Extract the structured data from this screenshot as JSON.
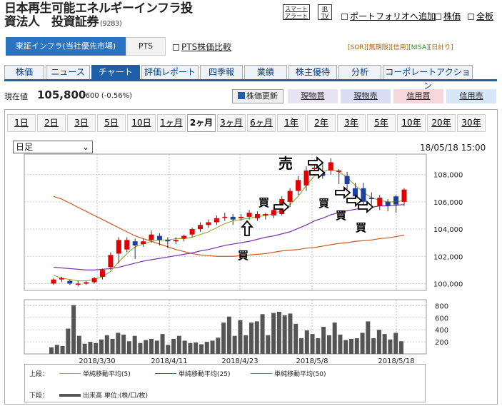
{
  "header": {
    "title_line1": "日本再生可能エネルギーインフラ投",
    "title_line2": "資法人　投資証券",
    "code": "(9283)",
    "smart_alert": "スマート アラート",
    "irtv": "IR TV",
    "portfolio": "ポートフォリオへ追加",
    "stock_price": "株価",
    "full_board": "全板"
  },
  "market": {
    "selected": "東証インフラ(当社優先市場)",
    "pts": "PTS",
    "pts_compare": "PTS株価比較",
    "flags": [
      "[SOR]",
      "[無期限]",
      "[信用]",
      "[NISA]",
      "[日計り]"
    ]
  },
  "tabs": [
    "株価",
    "ニュース",
    "チャート",
    "評価レポート",
    "四季報",
    "業績",
    "株主優待",
    "分析",
    "コーポレートアクション"
  ],
  "price": {
    "label": "現在値",
    "value": "105,800",
    "change": "-600 (-0.56%)",
    "refresh": "株価更新",
    "buy_spot": "現物買",
    "sell_spot": "現物売",
    "buy_margin": "信用買",
    "sell_margin": "信用売"
  },
  "periods": [
    "1日",
    "2日",
    "3日",
    "5日",
    "10日",
    "1ヶ月",
    "2ヶ月",
    "3ヶ月",
    "6ヶ月",
    "1年",
    "2年",
    "3年",
    "5年",
    "10年",
    "20年",
    "30年"
  ],
  "active_period": "2ヶ月",
  "select_value": "日足",
  "datetime": "18/05/18 15:00",
  "annotations": {
    "sell": "売",
    "buy": "買"
  },
  "legend": {
    "upper": "上段：",
    "lower": "下段：",
    "ma5": "単純移動平均(5)",
    "ma25": "単純移動平均(25)",
    "ma50": "単純移動平均(50)",
    "volume": "出来高 単位:(株/口/枚)"
  },
  "colors": {
    "up": "#e00000",
    "down": "#1c3fa0",
    "ma5": "#a2a93a",
    "ma25": "#7a2fb0",
    "ma50": "#c85a22",
    "volume": "#555555",
    "tab_blue": "#1f5fa8"
  },
  "chart_data": [
    {
      "type": "candlestick",
      "y_ticks": [
        100000,
        102000,
        104000,
        106000,
        108000
      ],
      "ylim": [
        99500,
        109500
      ],
      "x_labels": [
        "2018/3/30",
        "2018/4/11",
        "2018/4/23",
        "2018/5/8",
        "2018/5/18"
      ],
      "candles": [
        {
          "o": 100000,
          "c": 100300,
          "h": 100400,
          "l": 99900
        },
        {
          "o": 100300,
          "c": 100400,
          "h": 100500,
          "l": 100100
        },
        {
          "o": 100200,
          "c": 100000,
          "h": 100300,
          "l": 99900
        },
        {
          "o": 100000,
          "c": 100000,
          "h": 100200,
          "l": 99800
        },
        {
          "o": 100000,
          "c": 100100,
          "h": 100200,
          "l": 99900
        },
        {
          "o": 100100,
          "c": 100400,
          "h": 100500,
          "l": 100000
        },
        {
          "o": 100500,
          "c": 101000,
          "h": 101100,
          "l": 100300
        },
        {
          "o": 101200,
          "c": 102100,
          "h": 102300,
          "l": 101000
        },
        {
          "o": 102200,
          "c": 103200,
          "h": 103400,
          "l": 101500
        },
        {
          "o": 102500,
          "c": 103200,
          "h": 103400,
          "l": 102300
        },
        {
          "o": 103100,
          "c": 102800,
          "h": 103300,
          "l": 101800
        },
        {
          "o": 102900,
          "c": 103100,
          "h": 103300,
          "l": 102700
        },
        {
          "o": 103200,
          "c": 103600,
          "h": 103900,
          "l": 103000
        },
        {
          "o": 103500,
          "c": 103200,
          "h": 103700,
          "l": 102800
        },
        {
          "o": 103200,
          "c": 103100,
          "h": 103400,
          "l": 102600
        },
        {
          "o": 103100,
          "c": 103200,
          "h": 103400,
          "l": 102900
        },
        {
          "o": 103300,
          "c": 103500,
          "h": 103600,
          "l": 103100
        },
        {
          "o": 103600,
          "c": 104000,
          "h": 104100,
          "l": 103400
        },
        {
          "o": 104000,
          "c": 104300,
          "h": 104500,
          "l": 103800
        },
        {
          "o": 104300,
          "c": 104500,
          "h": 104700,
          "l": 104100
        },
        {
          "o": 104500,
          "c": 104800,
          "h": 105000,
          "l": 104300
        },
        {
          "o": 104900,
          "c": 104900,
          "h": 105200,
          "l": 104600
        },
        {
          "o": 104900,
          "c": 104700,
          "h": 105100,
          "l": 104300
        },
        {
          "o": 104800,
          "c": 104900,
          "h": 105100,
          "l": 104600
        },
        {
          "o": 104900,
          "c": 105200,
          "h": 105400,
          "l": 104700
        },
        {
          "o": 104800,
          "c": 105100,
          "h": 105300,
          "l": 104600
        },
        {
          "o": 105000,
          "c": 105100,
          "h": 105200,
          "l": 104700
        },
        {
          "o": 105000,
          "c": 105400,
          "h": 105600,
          "l": 104800
        },
        {
          "o": 105100,
          "c": 106200,
          "h": 106400,
          "l": 105000
        },
        {
          "o": 106000,
          "c": 106800,
          "h": 107000,
          "l": 105600
        },
        {
          "o": 106800,
          "c": 107600,
          "h": 107900,
          "l": 106500
        },
        {
          "o": 107200,
          "c": 108300,
          "h": 108600,
          "l": 106800
        },
        {
          "o": 108400,
          "c": 108500,
          "h": 109100,
          "l": 108000
        },
        {
          "o": 108200,
          "c": 107900,
          "h": 108800,
          "l": 107700
        },
        {
          "o": 108300,
          "c": 108900,
          "h": 109200,
          "l": 108000
        },
        {
          "o": 108200,
          "c": 108300,
          "h": 108400,
          "l": 107300
        },
        {
          "o": 107900,
          "c": 107300,
          "h": 108200,
          "l": 106800
        },
        {
          "o": 107000,
          "c": 106400,
          "h": 107400,
          "l": 106100
        },
        {
          "o": 107000,
          "c": 106000,
          "h": 107400,
          "l": 105600
        },
        {
          "o": 106300,
          "c": 106200,
          "h": 106700,
          "l": 105800
        },
        {
          "o": 105700,
          "c": 106300,
          "h": 106500,
          "l": 105400
        },
        {
          "o": 106000,
          "c": 105700,
          "h": 106200,
          "l": 105300
        },
        {
          "o": 106400,
          "c": 105800,
          "h": 106500,
          "l": 105200
        },
        {
          "o": 106000,
          "c": 106900,
          "h": 107000,
          "l": 105700
        }
      ],
      "ma5": [
        100600,
        100400,
        100300,
        100200,
        100200,
        100300,
        100500,
        100900,
        101600,
        102200,
        102700,
        102900,
        103100,
        103200,
        103200,
        103300,
        103300,
        103400,
        103600,
        103800,
        104100,
        104400,
        104600,
        104700,
        104800,
        104900,
        105000,
        105100,
        105400,
        105800,
        106400,
        107200,
        107900,
        108200,
        108400,
        108200,
        107800,
        107200,
        106700,
        106300,
        106100,
        106000,
        106000,
        106100
      ],
      "ma25": [
        101200,
        101150,
        101100,
        101050,
        101000,
        101000,
        101050,
        101100,
        101200,
        101350,
        101500,
        101650,
        101750,
        101850,
        101950,
        102050,
        102150,
        102250,
        102400,
        102500,
        102650,
        102800,
        102900,
        103000,
        103100,
        103250,
        103400,
        103500,
        103650,
        103800,
        104050,
        104300,
        104600,
        104800,
        105050,
        105200,
        105350,
        105450,
        105550,
        105600,
        105700,
        105700,
        105750,
        105800
      ],
      "ma50": [
        106400,
        106200,
        105900,
        105600,
        105300,
        105000,
        104700,
        104400,
        104100,
        103800,
        103500,
        103300,
        103100,
        102900,
        102700,
        102500,
        102350,
        102200,
        102100,
        102050,
        102000,
        102000,
        102000,
        102050,
        102100,
        102150,
        102200,
        102300,
        102400,
        102450,
        102500,
        102600,
        102650,
        102750,
        102850,
        102950,
        103000,
        103100,
        103150,
        103200,
        103300,
        103350,
        103450,
        103550
      ]
    },
    {
      "type": "bar",
      "y_ticks": [
        200,
        400,
        600,
        800
      ],
      "ylim": [
        0,
        900
      ],
      "values": [
        110,
        150,
        130,
        420,
        810,
        300,
        170,
        200,
        180,
        240,
        310,
        250,
        350,
        320,
        210,
        300,
        180,
        230,
        250,
        220,
        330,
        150,
        250,
        300,
        220,
        180,
        190,
        160,
        200,
        220,
        270,
        520,
        620,
        300,
        560,
        310,
        520,
        540,
        660,
        310,
        680,
        700,
        640,
        670,
        500,
        260,
        390,
        330,
        260,
        450,
        310,
        520,
        320,
        230,
        250,
        260,
        350,
        540,
        260,
        400,
        330,
        240,
        350,
        210
      ]
    }
  ]
}
